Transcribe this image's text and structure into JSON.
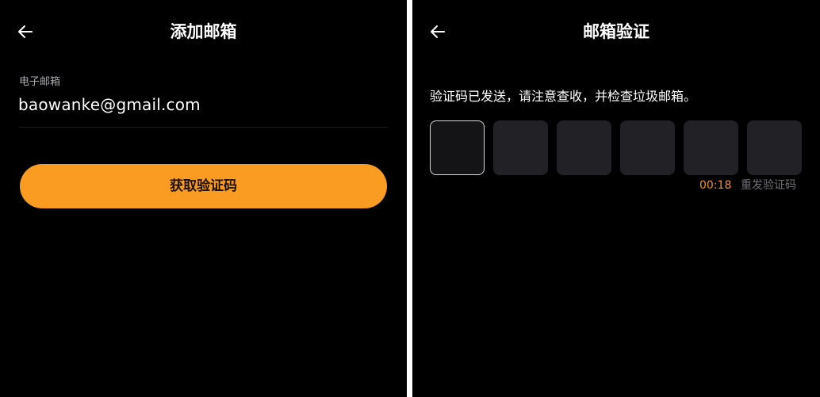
{
  "colors": {
    "background": "#000000",
    "primary": "#fa9c22",
    "countdown": "#f0912a",
    "code_box": "#222226",
    "muted": "#6f6f73"
  },
  "add_email_screen": {
    "back_icon": "arrow-left-icon",
    "title": "添加邮箱",
    "email_label": "电子邮箱",
    "email_value": "baowanke@gmail.com",
    "submit_label": "获取验证码"
  },
  "verify_screen": {
    "back_icon": "arrow-left-icon",
    "title": "邮箱验证",
    "hint": "验证码已发送，请注意查收，并检查垃圾邮箱。",
    "code_digits": [
      "",
      "",
      "",
      "",
      "",
      ""
    ],
    "countdown": "00:18",
    "resend_label": "重发验证码"
  }
}
